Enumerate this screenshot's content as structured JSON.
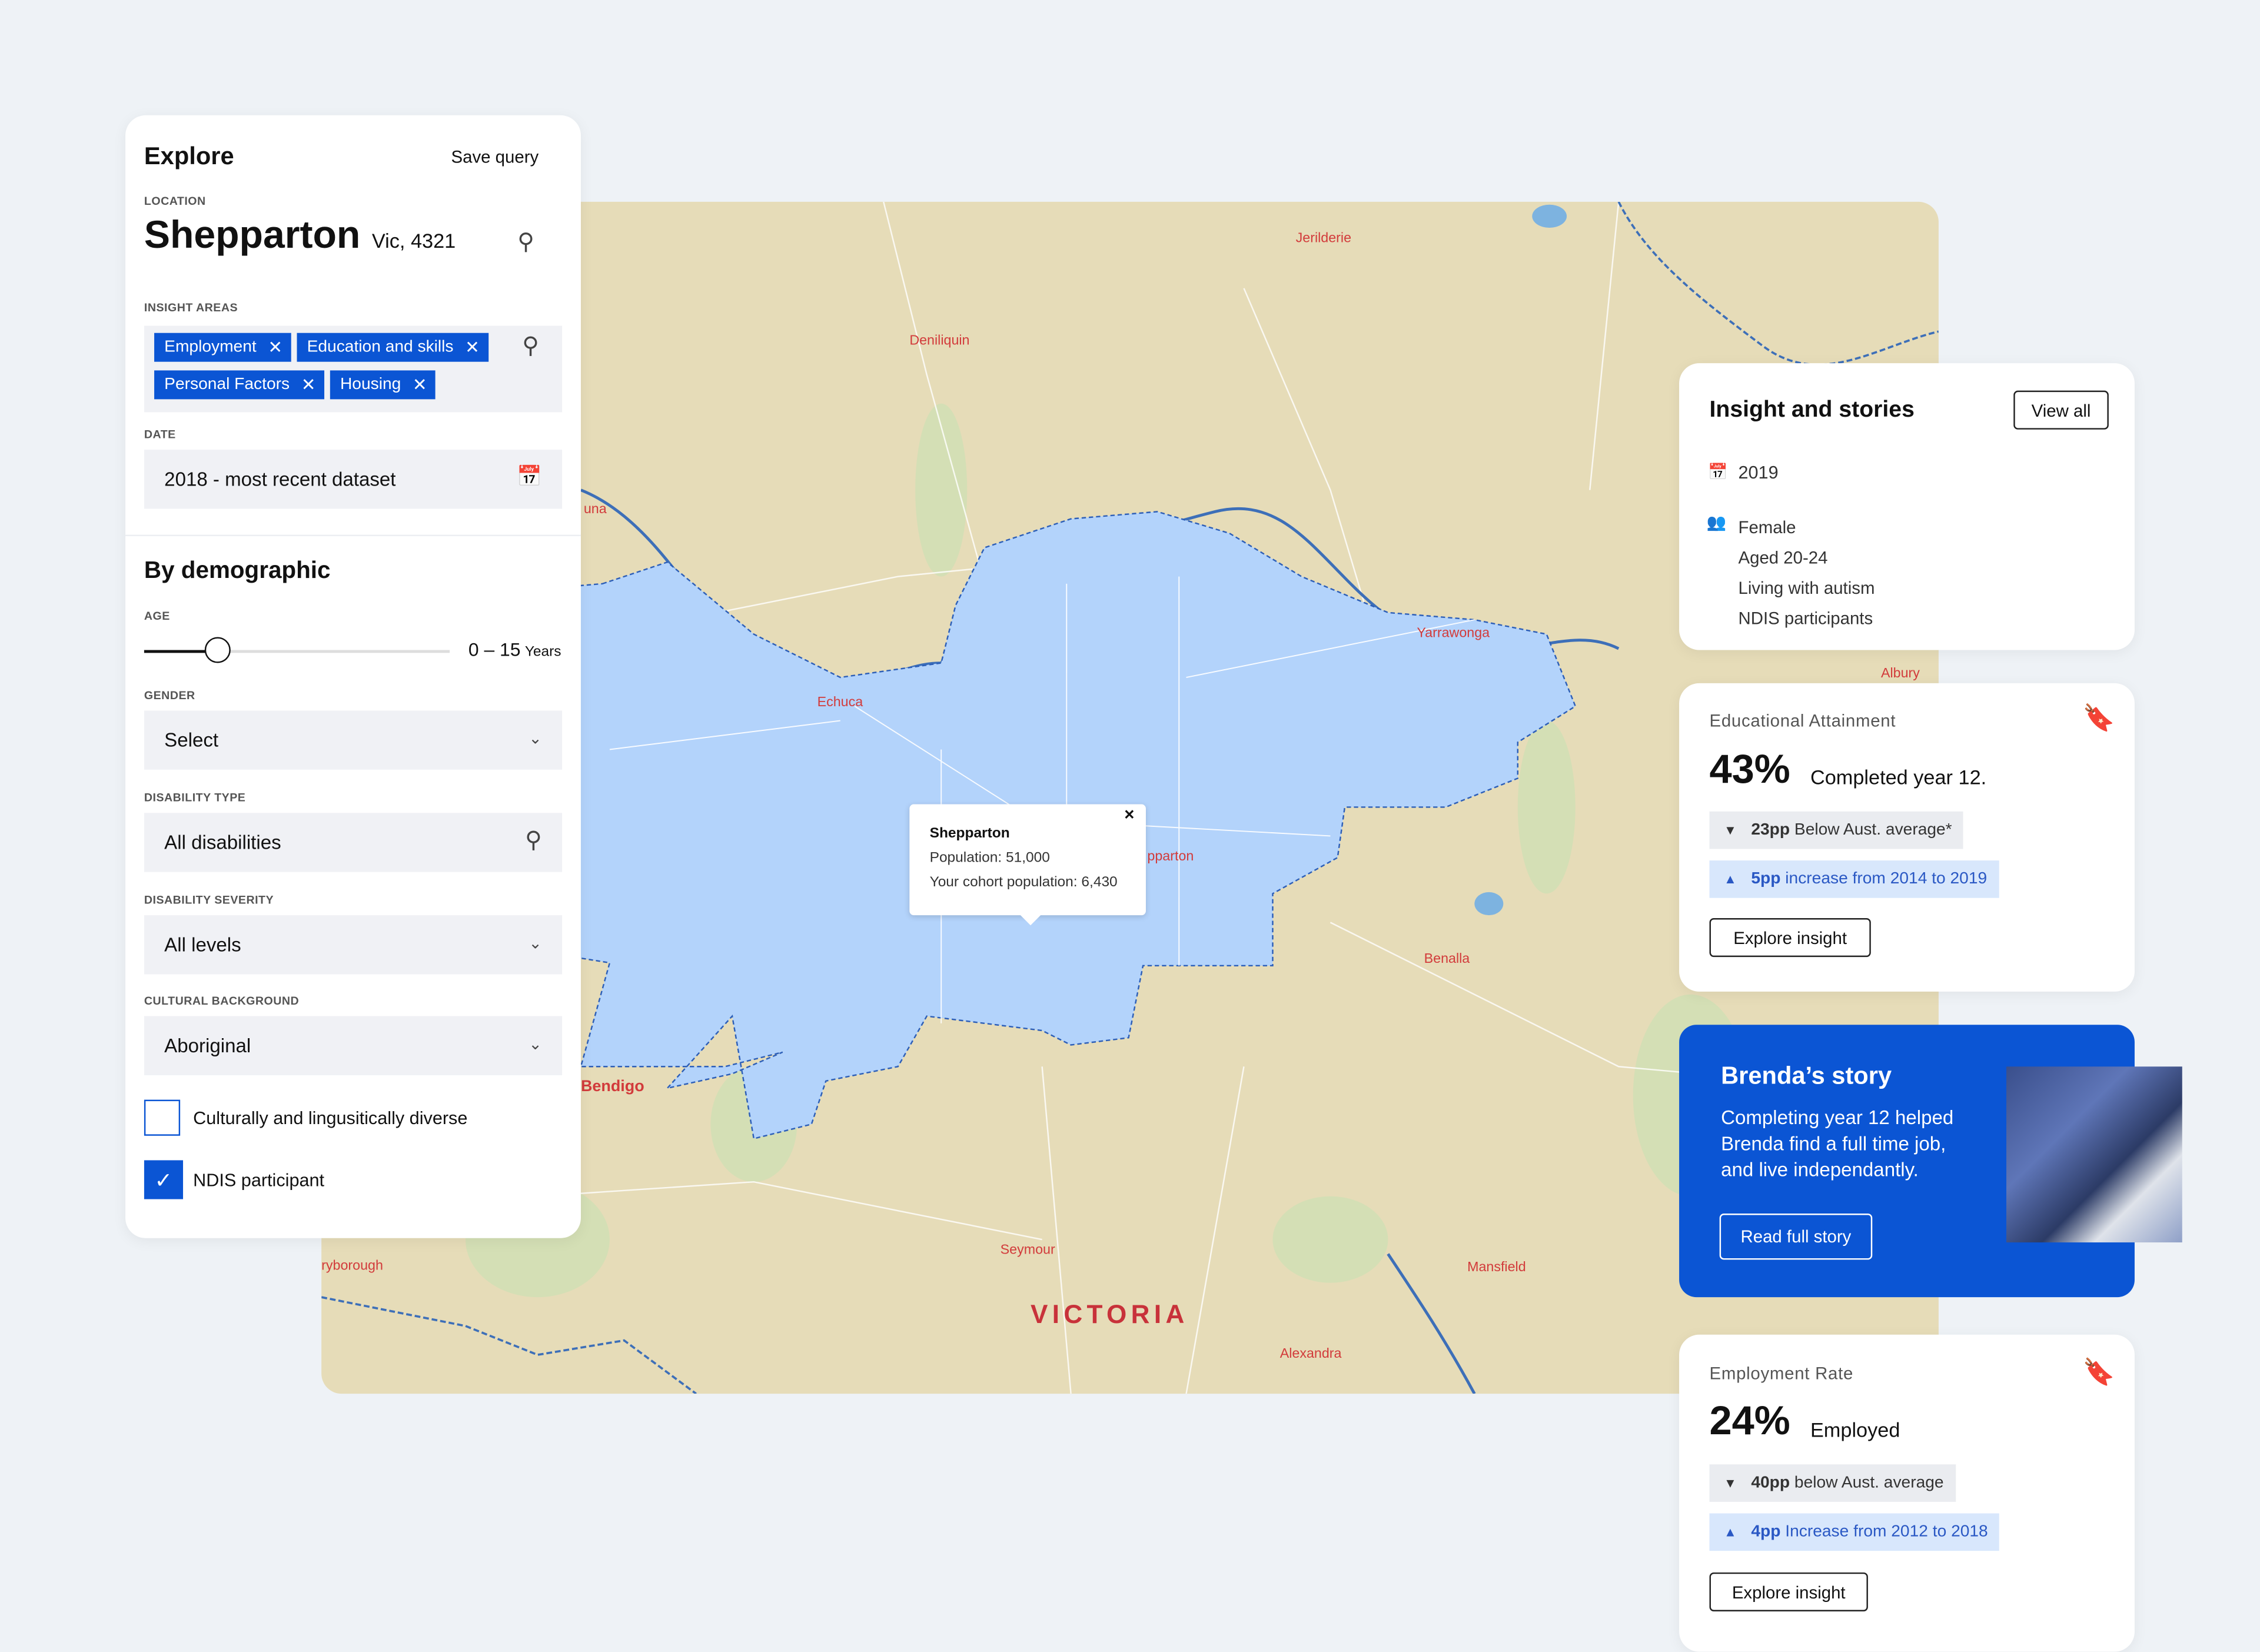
{
  "explore": {
    "title": "Explore",
    "save_query": "Save query",
    "location_label": "LOCATION",
    "location_name": "Shepparton",
    "location_detail": "Vic, 4321",
    "insight_areas_label": "INSIGHT AREAS",
    "insight_areas": [
      "Employment",
      "Education and skills",
      "Personal Factors",
      "Housing"
    ],
    "date_label": "DATE",
    "date_value": "2018 - most recent dataset",
    "demographic_title": "By demographic",
    "age_label": "AGE",
    "age_range": "0 – 15",
    "age_unit": "Years",
    "age_slider_fraction": 0.24,
    "gender_label": "GENDER",
    "gender_value": "Select",
    "disability_type_label": "DISABILITY TYPE",
    "disability_type_value": "All disabilities",
    "disability_severity_label": "DISABILITY SEVERITY",
    "disability_severity_value": "All levels",
    "cultural_label": "CULTURAL BACKGROUND",
    "cultural_value": "Aboriginal",
    "checkbox_cald": {
      "label": "Culturally and lingusitically diverse",
      "checked": false
    },
    "checkbox_ndis": {
      "label": "NDIS participant",
      "checked": true
    }
  },
  "map": {
    "labels": [
      "Jerilderie",
      "Deniliquin",
      "Echuca",
      "Yarrawonga",
      "Albury",
      "pparton",
      "Benalla",
      "Bendigo",
      "Seymour",
      "Mansfield",
      "Alexandra",
      "ryborough",
      "una"
    ],
    "region_label": "VICTORIA",
    "tooltip": {
      "title": "Shepparton",
      "population": "Population: 51,000",
      "cohort": "Your cohort population: 6,430",
      "close": "×"
    }
  },
  "insights": {
    "title": "Insight and stories",
    "view_all": "View all",
    "year": "2019",
    "cohort": [
      "Female",
      "Aged 20-24",
      "Living with autism",
      "NDIS participants"
    ]
  },
  "education": {
    "title": "Educational Attainment",
    "value": "43%",
    "caption": "Completed year 12.",
    "compare_bold": "23pp",
    "compare_text": "Below Aust. average*",
    "trend_bold": "5pp",
    "trend_text": "increase from 2014 to 2019",
    "button": "Explore insight"
  },
  "story": {
    "title": "Brenda’s story",
    "body": "Completing year 12 helped Brenda find a full time job, and live independantly.",
    "button": "Read full story"
  },
  "employment": {
    "title": "Employment Rate",
    "value": "24%",
    "caption": "Employed",
    "compare_bold": "40pp",
    "compare_text": "below Aust. average",
    "trend_bold": "4pp",
    "trend_text": "Increase  from 2012 to 2018",
    "button": "Explore insight"
  },
  "colors": {
    "accent": "#0b55d4",
    "map_land": "#e6dcb8",
    "map_region": "#b3d3fb",
    "label_red": "#d23b3b"
  }
}
